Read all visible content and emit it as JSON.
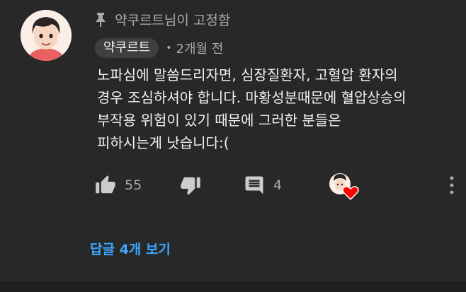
{
  "pinned": {
    "label": "약쿠르트님이 고정함",
    "icon": "pin-icon"
  },
  "comment": {
    "author": "약쿠르트",
    "time": "2개월 전",
    "text": "노파심에 말씀드리자면, 심장질환자, 고혈압 환자의\n경우 조심하셔야 합니다. 마황성분때문에 혈압상승의\n부작용 위험이 있기 때문에 그러한 분들은\n피하시는게 낫습니다:(",
    "like_count": "55",
    "reply_count": "4"
  },
  "replies_label": "답글 4개 보기",
  "colors": {
    "background": "#282828",
    "link": "#3ea6ff",
    "heart": "#ff0000",
    "muted": "#aaaaaa"
  }
}
